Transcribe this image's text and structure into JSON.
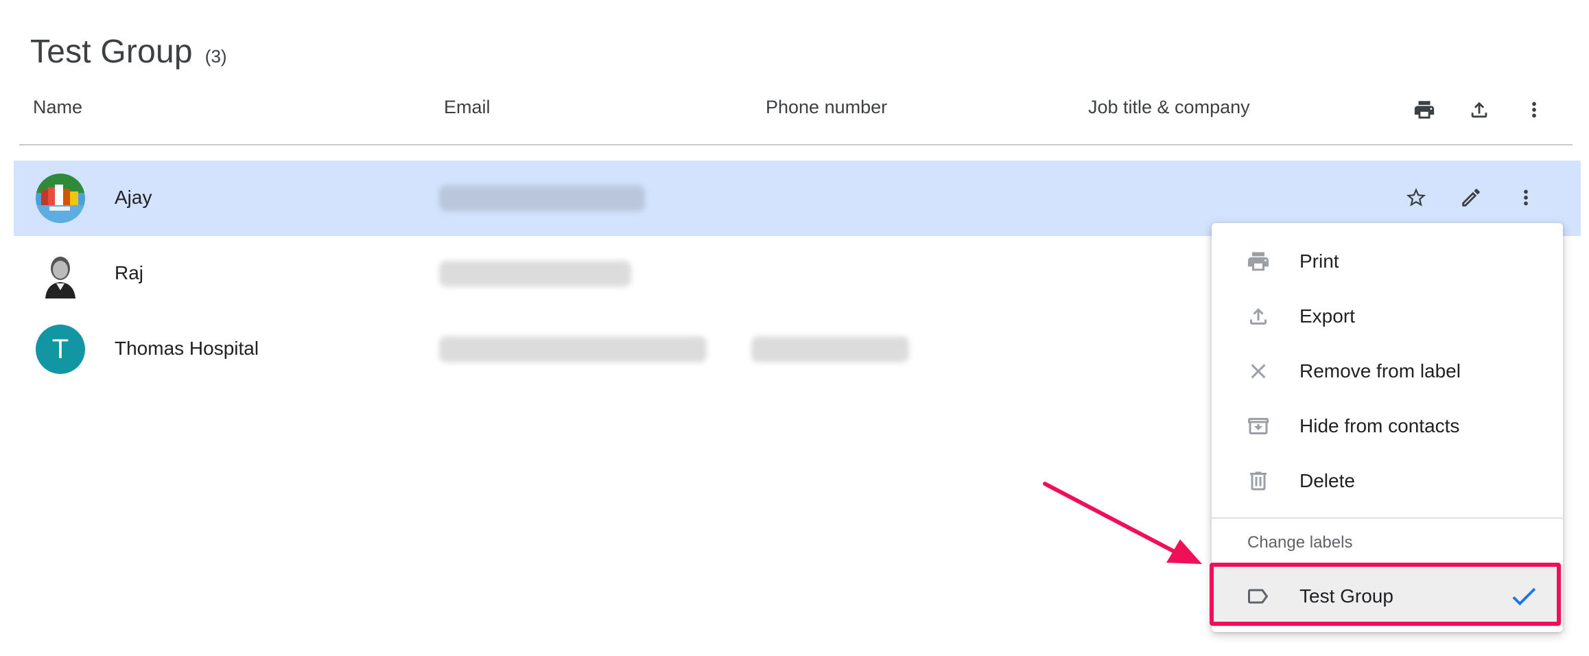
{
  "page": {
    "title": "Test Group",
    "count": "(3)"
  },
  "table": {
    "headers": {
      "name": "Name",
      "email": "Email",
      "phone": "Phone number",
      "job": "Job title & company"
    },
    "header_action_icons": [
      "print-icon",
      "export-icon",
      "more-vert-icon"
    ],
    "rows": [
      {
        "name": "Ajay",
        "avatar": "photo",
        "selected": true
      },
      {
        "name": "Raj",
        "avatar": "photo",
        "selected": false
      },
      {
        "name": "Thomas Hospital",
        "avatar": "T",
        "selected": false
      }
    ],
    "row_action_icons": [
      "star-icon",
      "edit-icon",
      "more-vert-icon"
    ]
  },
  "menu": {
    "items": [
      {
        "label": "Print",
        "icon": "print-icon"
      },
      {
        "label": "Export",
        "icon": "export-icon"
      },
      {
        "label": "Remove from label",
        "icon": "close-icon"
      },
      {
        "label": "Hide from contacts",
        "icon": "archive-icon"
      },
      {
        "label": "Delete",
        "icon": "trash-icon"
      }
    ],
    "section_label": "Change labels",
    "labels": [
      {
        "label": "Test Group",
        "icon": "label-icon",
        "checked": true
      }
    ]
  },
  "colors": {
    "selected_row": "#d3e3fd",
    "avatar_teal": "#1296a3",
    "check_blue": "#1a73e8",
    "annotation": "#f0105a"
  }
}
